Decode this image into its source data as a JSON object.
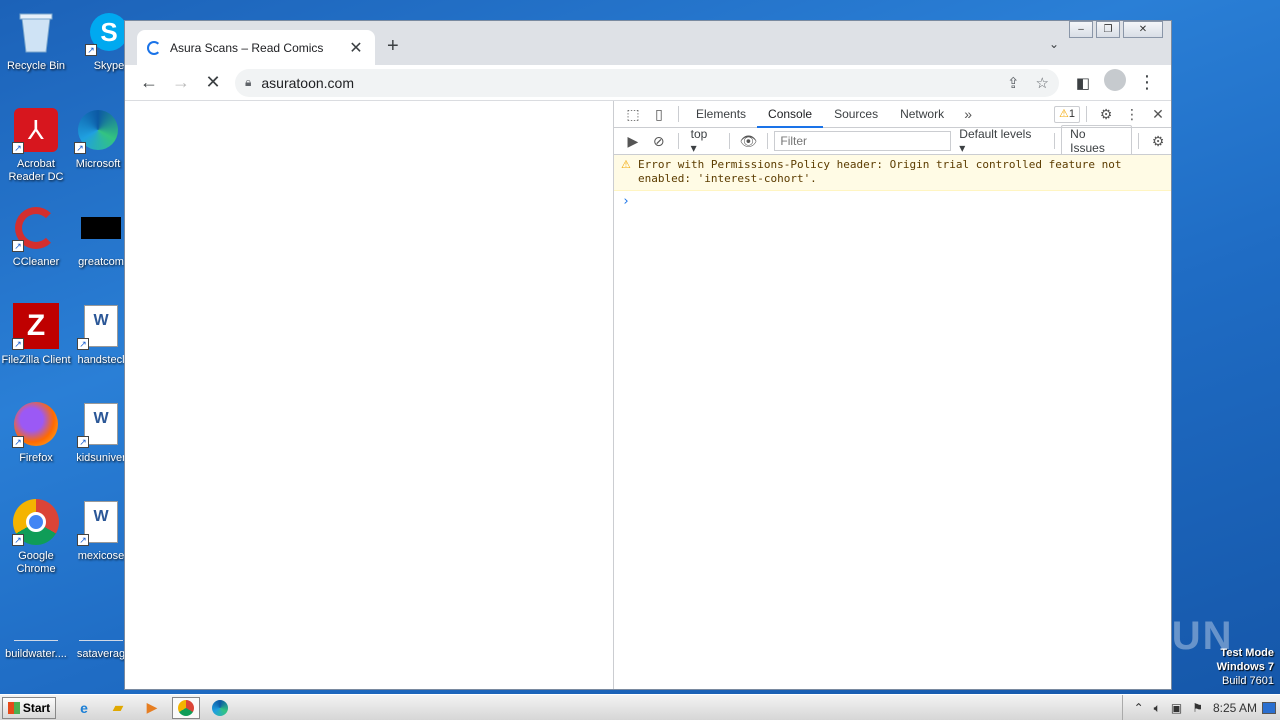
{
  "desktop": {
    "icons": [
      {
        "label": "Recycle Bin",
        "icon": "recycle-bin-icon"
      },
      {
        "label": "Skype",
        "icon": "skype-icon"
      },
      {
        "label": "Acrobat Reader DC",
        "icon": "acrobat-icon"
      },
      {
        "label": "Microsoft",
        "icon": "edge-icon"
      },
      {
        "label": "CCleaner",
        "icon": "ccleaner-icon"
      },
      {
        "label": "greatcom",
        "icon": "file-icon"
      },
      {
        "label": "FileZilla Client",
        "icon": "filezilla-icon"
      },
      {
        "label": "handstecl",
        "icon": "word-doc-icon"
      },
      {
        "label": "Firefox",
        "icon": "firefox-icon"
      },
      {
        "label": "kidsuniver",
        "icon": "word-doc-icon"
      },
      {
        "label": "Google Chrome",
        "icon": "chrome-icon"
      },
      {
        "label": "mexicose",
        "icon": "word-doc-icon"
      },
      {
        "label": "buildwater....",
        "icon": "file-icon"
      },
      {
        "label": "sataverag",
        "icon": "file-icon"
      }
    ]
  },
  "browser": {
    "tab_title": "Asura Scans – Read Comics",
    "url": "asuratoon.com",
    "win_controls": [
      "–",
      "❐",
      "✕"
    ]
  },
  "devtools": {
    "tabs": [
      "Elements",
      "Console",
      "Sources",
      "Network"
    ],
    "active_tab": "Console",
    "more": "»",
    "warning_count": "1",
    "context": "top",
    "filter_placeholder": "Filter",
    "levels": "Default levels",
    "issues": "No Issues",
    "message": "Error with Permissions-Policy header: Origin trial controlled feature not enabled: 'interest-cohort'.",
    "prompt": "›"
  },
  "taskbar": {
    "start": "Start",
    "clock": "8:25 AM"
  },
  "watermark": {
    "line1": "Test Mode",
    "line2": "Windows 7",
    "line3": "Build 7601",
    "brand": "ANY RUN"
  }
}
